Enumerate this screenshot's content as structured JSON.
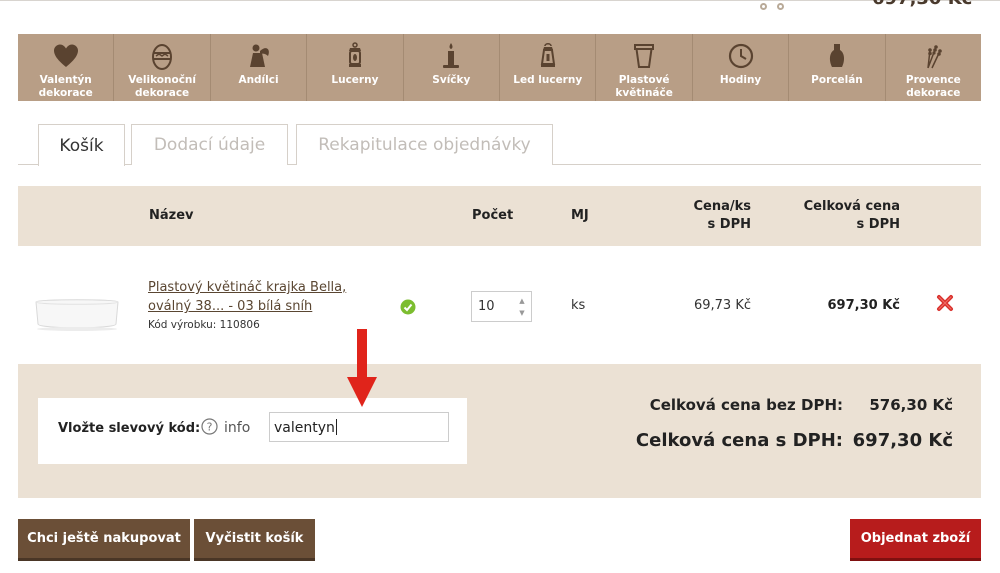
{
  "header": {
    "top_price": "697,30 Kč"
  },
  "categories": [
    {
      "label": "Valentýn\ndekorace",
      "icon": "heart-icon"
    },
    {
      "label": "Velikonoční\ndekorace",
      "icon": "easter-egg-icon"
    },
    {
      "label": "Andílci",
      "icon": "angel-icon"
    },
    {
      "label": "Lucerny",
      "icon": "lantern-icon"
    },
    {
      "label": "Svíčky",
      "icon": "candle-icon"
    },
    {
      "label": "Led lucerny",
      "icon": "led-lantern-icon"
    },
    {
      "label": "Plastové\nkvětináče",
      "icon": "flowerpot-icon"
    },
    {
      "label": "Hodiny",
      "icon": "clock-icon"
    },
    {
      "label": "Porcelán",
      "icon": "vase-icon"
    },
    {
      "label": "Provence\ndekorace",
      "icon": "lavender-icon"
    }
  ],
  "tabs": {
    "cart": "Košík",
    "delivery": "Dodací údaje",
    "summary": "Rekapitulace objednávky"
  },
  "table": {
    "headers": {
      "name": "Název",
      "quantity": "Počet",
      "unit": "MJ",
      "unit_price": "Cena/ks\ns DPH",
      "total_price": "Celková cena\ns DPH"
    },
    "rows": [
      {
        "name": "Plastový květináč krajka Bella, oválný 38... - 03 bílá sníh",
        "code": "Kód výrobku: 110806",
        "quantity": "10",
        "unit": "ks",
        "unit_price": "69,73 Kč",
        "total_price": "697,30 Kč"
      }
    ]
  },
  "discount": {
    "label": "Vložte slevový kód:",
    "info": "info",
    "value": "valentyn"
  },
  "totals": {
    "without_vat_label": "Celková cena bez DPH:",
    "without_vat_value": "576,30 Kč",
    "with_vat_label": "Celková cena s DPH:",
    "with_vat_value": "697,30 Kč"
  },
  "buttons": {
    "continue_shopping": "Chci ještě nakupovat",
    "clear_cart": "Vyčistit košík",
    "order": "Objednat zboží"
  },
  "colors": {
    "nav_bg": "#b89e86",
    "brown_button": "#6b4f37",
    "order_button": "#b71c1c",
    "table_bg": "#ebe1d4",
    "arrow": "#e0241b"
  }
}
